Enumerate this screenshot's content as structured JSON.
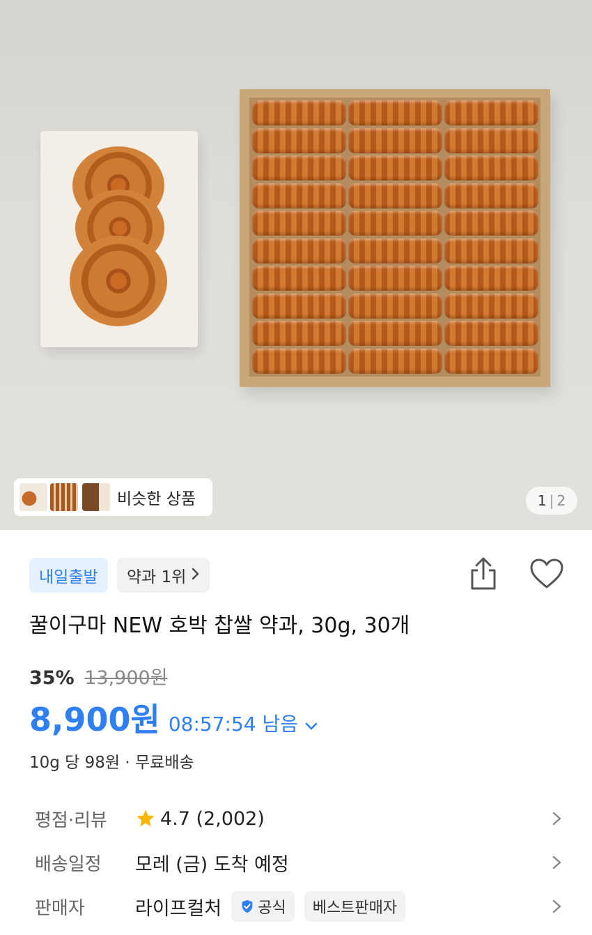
{
  "hero": {
    "similar_label": "비슷한 상품",
    "pager": {
      "current": "1",
      "separator": "|",
      "total": "2"
    }
  },
  "badges": {
    "delivery": "내일출발",
    "ranking": "약과 1위"
  },
  "product": {
    "title": "꿀이구마 NEW 호박 찹쌀 약과, 30g, 30개",
    "discount": "35%",
    "original_price": "13,900원",
    "price": "8,900원",
    "timer": "08:57:54 남음",
    "unit_info": "10g 당 98원 · 무료배송"
  },
  "info": {
    "rating_label": "평점·리뷰",
    "rating_value": "4.7 (2,002)",
    "delivery_label": "배송일정",
    "delivery_value": "모레 (금) 도착 예정",
    "seller_label": "판매자",
    "seller_value": "라이프컬처",
    "official_badge": "공식",
    "best_seller_badge": "베스트판매자"
  },
  "colors": {
    "accent": "#2e7ff0",
    "star": "#f7b500"
  },
  "icons": [
    "share-icon",
    "heart-icon",
    "star-icon",
    "check-badge-icon",
    "chevron-right-icon",
    "chevron-down-icon"
  ]
}
